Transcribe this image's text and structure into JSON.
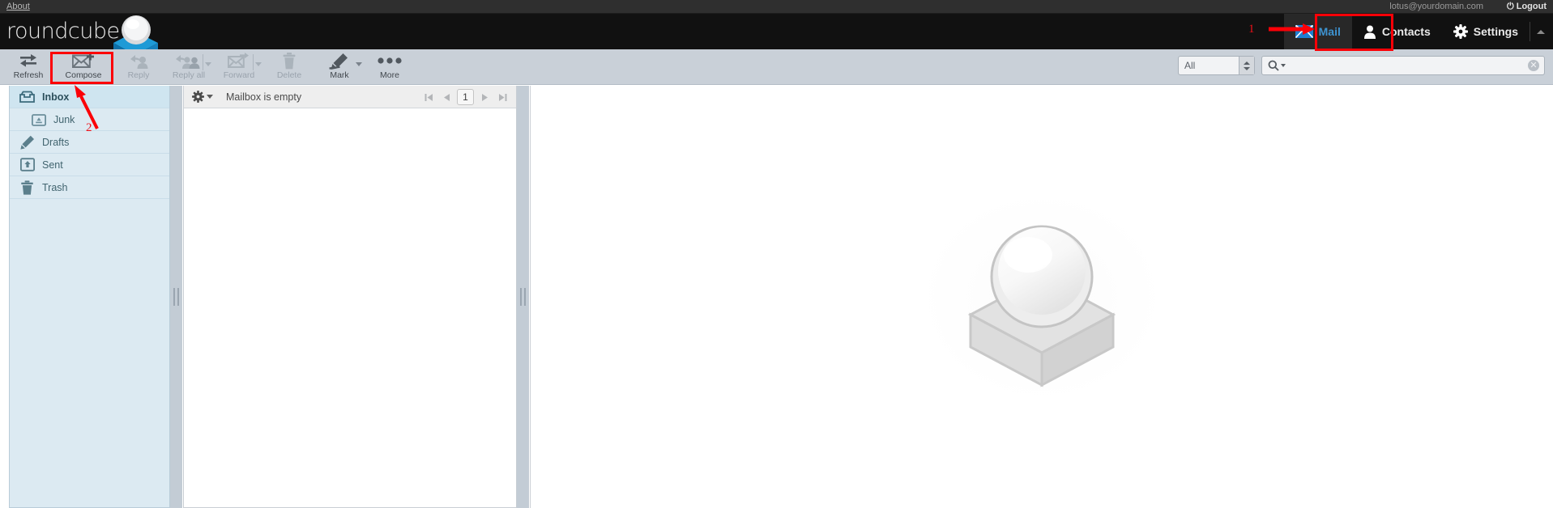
{
  "topbar": {
    "about_label": "About",
    "user_email": "lotus@yourdomain.com",
    "logout_label": "Logout",
    "power_icon": "power-icon"
  },
  "header": {
    "brand": "roundcube",
    "logo_icon": "roundcube-cube-logo",
    "tasks": [
      {
        "label": "Mail",
        "icon": "envelope-icon",
        "selected": true
      },
      {
        "label": "Contacts",
        "icon": "person-icon",
        "selected": false
      },
      {
        "label": "Settings",
        "icon": "gear-icon",
        "selected": false
      }
    ],
    "collapse_icon": "chevron-up-icon"
  },
  "toolbar": {
    "buttons": [
      {
        "label": "Refresh",
        "icon": "refresh-arrows-icon",
        "disabled": false,
        "dropdown": false
      },
      {
        "label": "Compose",
        "icon": "envelope-plus-icon",
        "disabled": false,
        "dropdown": false
      },
      {
        "label": "Reply",
        "icon": "reply-person-icon",
        "disabled": true,
        "dropdown": false
      },
      {
        "label": "Reply all",
        "icon": "reply-all-people-icon",
        "disabled": true,
        "dropdown": true
      },
      {
        "label": "Forward",
        "icon": "forward-envelope-icon",
        "disabled": true,
        "dropdown": true
      },
      {
        "label": "Delete",
        "icon": "trash-icon",
        "disabled": true,
        "dropdown": false
      },
      {
        "label": "Mark",
        "icon": "marker-pen-icon",
        "disabled": false,
        "dropdown": true
      },
      {
        "label": "More",
        "icon": "ellipsis-icon",
        "disabled": false,
        "dropdown": false
      }
    ],
    "search_scope": "All",
    "search_value": "",
    "search_placeholder": "",
    "search_icon": "magnifier-icon",
    "clear_icon": "clear-x-icon"
  },
  "folders": [
    {
      "label": "Inbox",
      "icon": "inbox-icon",
      "selected": true,
      "nested": false
    },
    {
      "label": "Junk",
      "icon": "junk-icon",
      "selected": false,
      "nested": true
    },
    {
      "label": "Drafts",
      "icon": "pencil-icon",
      "selected": false,
      "nested": false
    },
    {
      "label": "Sent",
      "icon": "sent-icon",
      "selected": false,
      "nested": false
    },
    {
      "label": "Trash",
      "icon": "trash-icon",
      "selected": false,
      "nested": false
    }
  ],
  "messagelist": {
    "options_icon": "gear-icon",
    "status_text": "Mailbox is empty",
    "pager": {
      "first_icon": "first-page-icon",
      "prev_icon": "prev-page-icon",
      "page_number": "1",
      "next_icon": "next-page-icon",
      "last_icon": "last-page-icon"
    }
  },
  "preview": {
    "watermark_icon": "roundcube-watermark-logo"
  },
  "annotations": {
    "step1": "1",
    "step2": "2",
    "highlight_color": "#fb0007"
  }
}
